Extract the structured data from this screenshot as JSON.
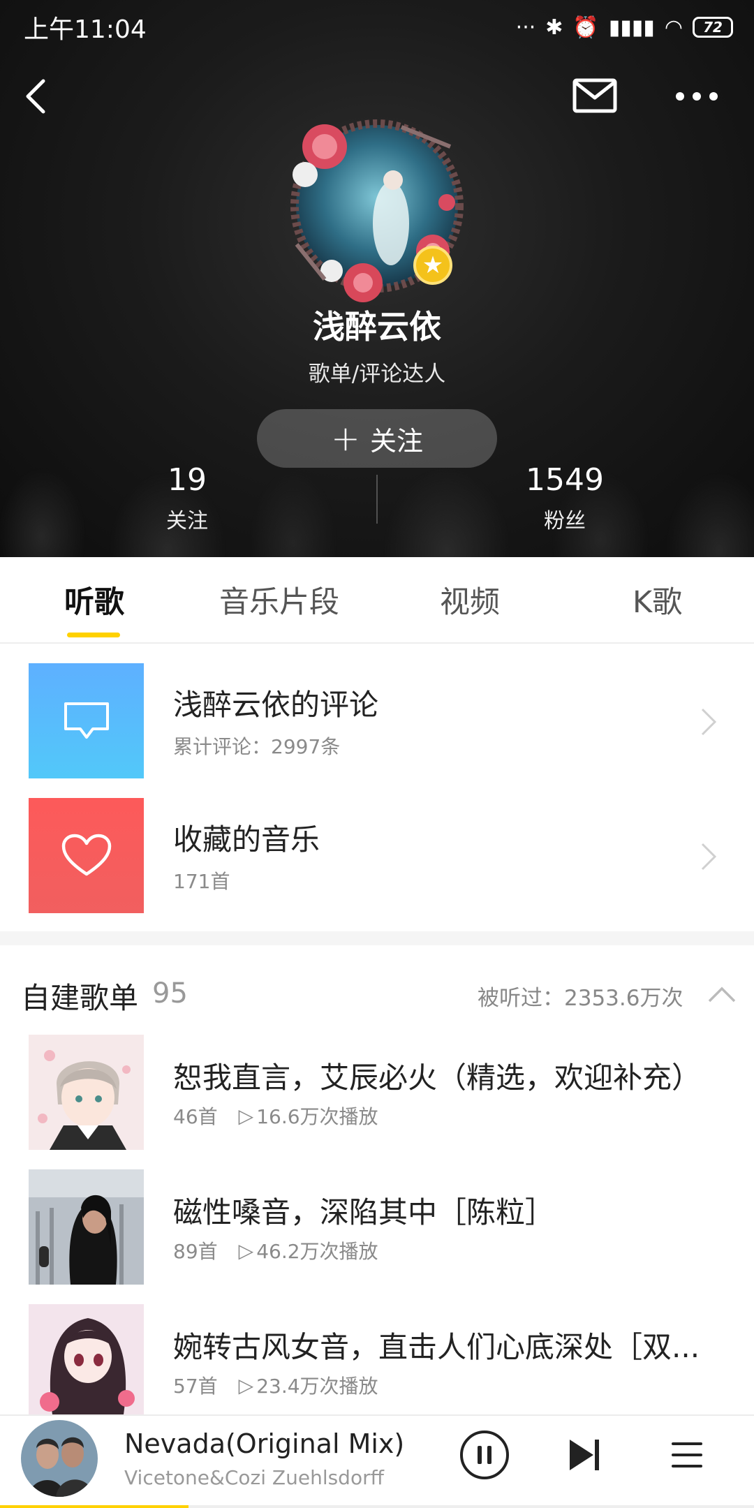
{
  "status_bar": {
    "time": "上午11:04",
    "battery": "72"
  },
  "profile": {
    "name": "浅醉云依",
    "tag": "歌单/评论达人",
    "follow_label": "关注",
    "following_count": "19",
    "following_label": "关注",
    "fans_count": "1549",
    "fans_label": "粉丝"
  },
  "tabs": [
    {
      "label": "听歌",
      "active": true
    },
    {
      "label": "音乐片段",
      "active": false
    },
    {
      "label": "视频",
      "active": false
    },
    {
      "label": "K歌",
      "active": false
    }
  ],
  "quick_items": [
    {
      "title": "浅醉云依的评论",
      "subtitle": "累计评论：2997条",
      "icon": "comment-icon"
    },
    {
      "title": "收藏的音乐",
      "subtitle": "171首",
      "icon": "heart-icon"
    }
  ],
  "playlists_section": {
    "title": "自建歌单",
    "count": "95",
    "listened": "被听过：2353.6万次"
  },
  "playlists": [
    {
      "title": "恕我直言，艾辰必火（精选，欢迎补充）",
      "songs": "46首",
      "plays": "16.6万次播放"
    },
    {
      "title": "磁性嗓音，深陷其中［陈粒］",
      "songs": "89首",
      "plays": "46.2万次播放"
    },
    {
      "title": "婉转古风女音，直击人们心底深处［双...",
      "songs": "57首",
      "plays": "23.4万次播放"
    }
  ],
  "player": {
    "title": "Nevada(Original Mix)",
    "artist": "Vicetone&Cozi Zuehlsdorff",
    "progress": 0.25
  },
  "colors": {
    "accent": "#ffd100",
    "comment_tile": "#5ab6fd",
    "heart_tile": "#f75d5d"
  }
}
